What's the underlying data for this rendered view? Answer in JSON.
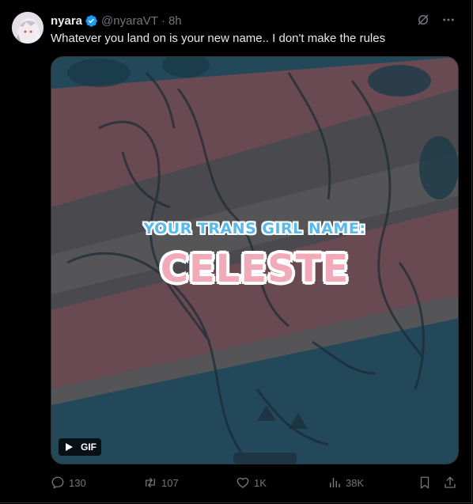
{
  "author": {
    "name": "nyara",
    "handle": "@nyaraVT",
    "time": "8h",
    "separator": "·"
  },
  "tweet_text": "Whatever you land on is your new name.. I don't make the rules",
  "media": {
    "caption_top": "YOUR TRANS GIRL NAME:",
    "caption_name": "CELESTE",
    "badge": "GIF"
  },
  "actions": {
    "replies": "130",
    "reposts": "107",
    "likes": "1K",
    "views": "38K"
  },
  "colors": {
    "background": "#000000",
    "text_primary": "#e7e9ea",
    "text_secondary": "#71767b",
    "verified": "#1d9bf0",
    "caption_blue": "#57b9ec",
    "caption_pink": "#f2a9b8"
  },
  "icons": [
    "verified-badge-icon",
    "grok-icon",
    "more-icon",
    "play-icon",
    "reply-icon",
    "repost-icon",
    "like-icon",
    "views-icon",
    "bookmark-icon",
    "share-icon"
  ]
}
